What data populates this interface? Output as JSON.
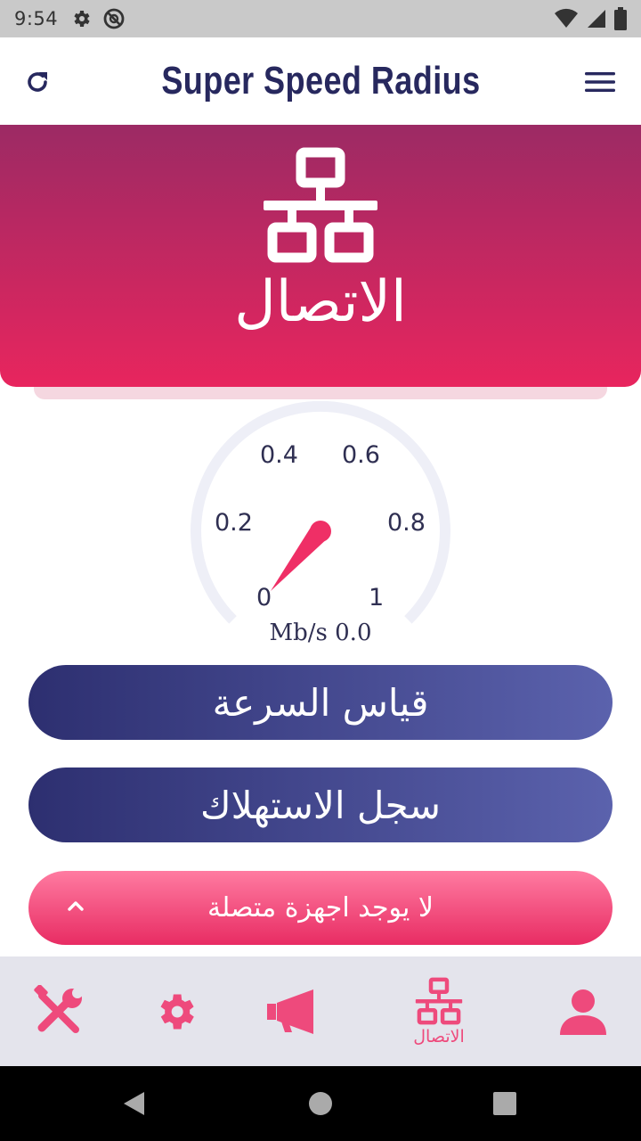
{
  "status_bar": {
    "time": "9:54",
    "left_icons": [
      "gear-icon",
      "block-icon"
    ],
    "right_icons": [
      "wifi-icon",
      "signal-icon",
      "battery-icon"
    ]
  },
  "app_bar": {
    "title": "Super Speed Radius",
    "left_action": "refresh-icon",
    "right_action": "menu-icon"
  },
  "hero": {
    "icon": "network-icon",
    "title": "الاتصال",
    "colors": {
      "top": "#9c2a64",
      "bottom": "#e8255e"
    }
  },
  "gauge": {
    "ticks": [
      "0",
      "0.2",
      "0.4",
      "0.6",
      "0.8",
      "1"
    ],
    "value": 0,
    "unit": "Mb/s",
    "readout": "Mb/s 0.0",
    "colors": {
      "track": "#eeeff7",
      "needle": "#ef2f66"
    }
  },
  "buttons": {
    "speed_test": "قياس السرعة",
    "usage_log": "سجل الاستهلاك",
    "devices": "لا يوجد اجهزة متصلة"
  },
  "bottom_nav": {
    "items": [
      {
        "icon": "tools-icon",
        "label": ""
      },
      {
        "icon": "gear-icon",
        "label": ""
      },
      {
        "icon": "megaphone-icon",
        "label": ""
      },
      {
        "icon": "network-icon",
        "label": "الاتصال",
        "active": true
      },
      {
        "icon": "person-icon",
        "label": ""
      }
    ],
    "accent": "#ee4a7c"
  },
  "system_nav": {
    "buttons": [
      "back-icon",
      "home-icon",
      "recents-icon"
    ]
  }
}
